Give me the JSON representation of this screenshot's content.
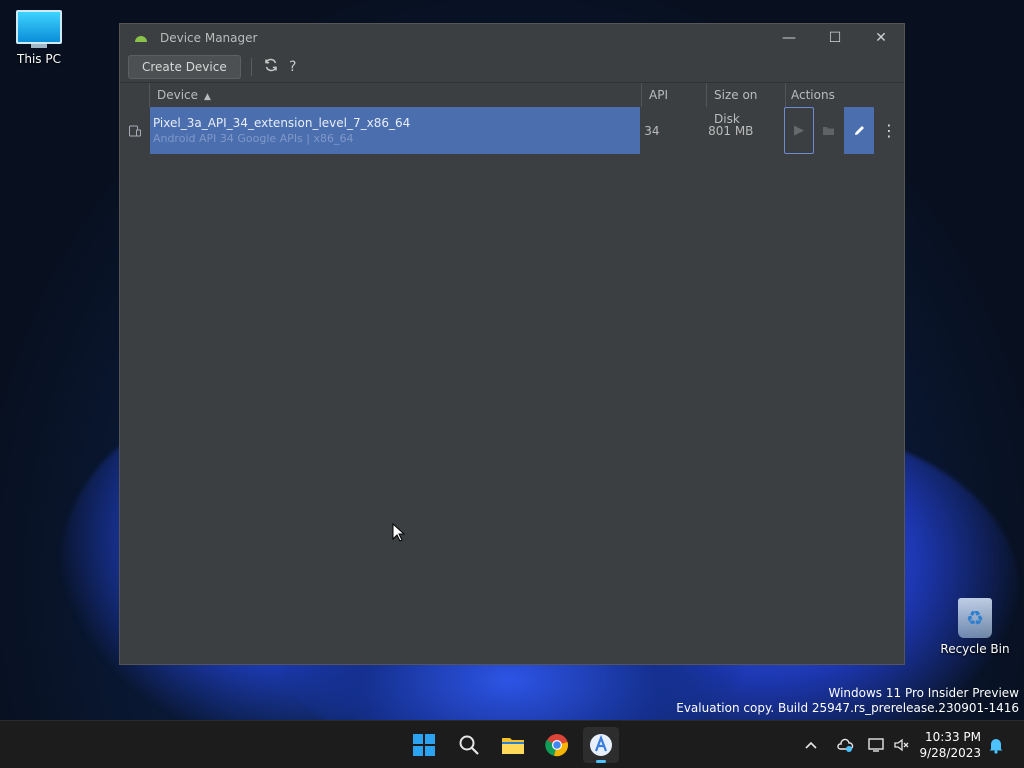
{
  "desktop": {
    "icons": [
      {
        "label": "This PC",
        "icon": "computer-icon"
      },
      {
        "label": "Recycle Bin",
        "icon": "recycle-bin-icon"
      }
    ],
    "watermark": {
      "line1": "Windows 11 Pro Insider Preview",
      "line2": "Evaluation copy. Build 25947.rs_prerelease.230901-1416"
    }
  },
  "window": {
    "title": "Device Manager",
    "controls": {
      "minimize": "—",
      "maximize": "☐",
      "close": "✕"
    },
    "toolbar": {
      "create_label": "Create Device",
      "refresh_icon": "refresh-icon",
      "help_label": "?"
    },
    "table": {
      "columns": {
        "device": "Device",
        "api": "API",
        "size": "Size on Disk",
        "actions": "Actions"
      },
      "rows": [
        {
          "name": "Pixel_3a_API_34_extension_level_7_x86_64",
          "subtitle": "Android API 34 Google APIs | x86_64",
          "api": "34",
          "size": "801 MB",
          "selected": true
        }
      ]
    },
    "accent_color": "#4b6eaf"
  },
  "taskbar": {
    "apps": [
      "start-icon",
      "search-icon",
      "file-explorer-icon",
      "chrome-icon",
      "android-studio-icon"
    ],
    "tray": {
      "time": "10:33 PM",
      "date": "9/28/2023"
    }
  }
}
